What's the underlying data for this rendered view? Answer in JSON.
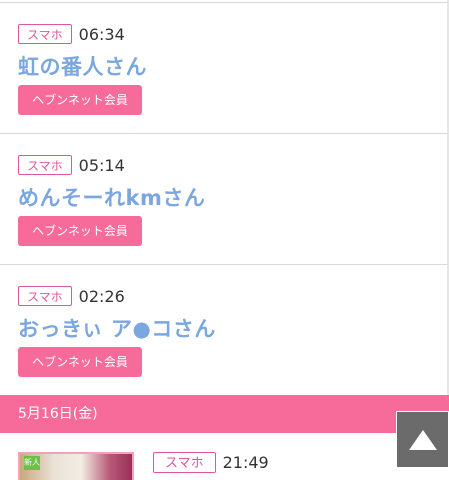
{
  "entries": [
    {
      "device": "スマホ",
      "time": "06:34",
      "name": "虹の番人さん",
      "member_label": "ヘブンネット会員"
    },
    {
      "device": "スマホ",
      "time": "05:14",
      "name": "めんそーれkmさん",
      "member_label": "ヘブンネット会員"
    },
    {
      "device": "スマホ",
      "time": "02:26",
      "name": "おっきぃ ア●コさん",
      "member_label": "ヘブンネット会員"
    }
  ],
  "date_header": "5月16日(金)",
  "preview": {
    "device": "スマホ",
    "time": "21:49",
    "thumb_tag": "新人"
  },
  "colors": {
    "accent_pink": "#f76b9a",
    "badge_border": "#e0559f",
    "name_blue": "#7aa7e0",
    "scroll_button": "#6b6b6b"
  },
  "icons": {
    "scroll_top": "triangle-up-icon"
  }
}
